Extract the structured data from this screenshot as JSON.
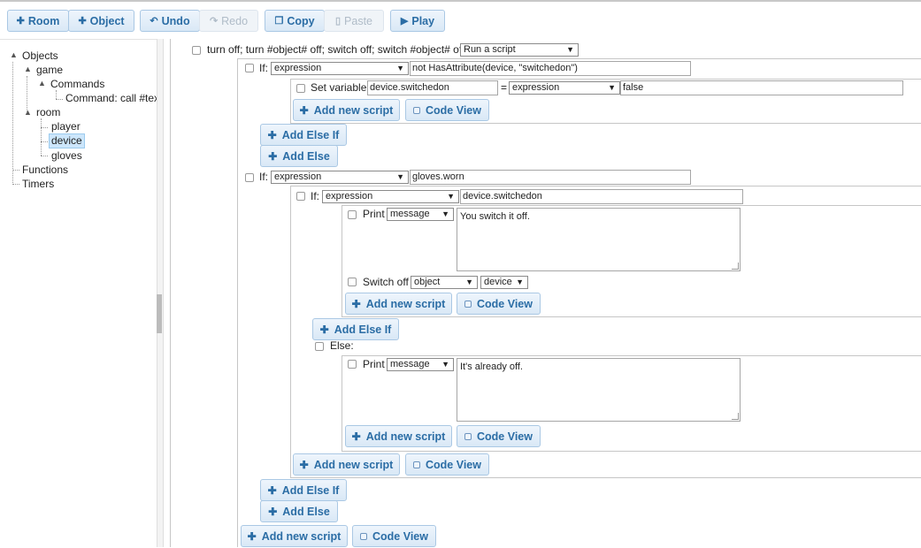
{
  "toolbar": {
    "room": "Room",
    "object": "Object",
    "undo": "Undo",
    "redo": "Redo",
    "copy": "Copy",
    "paste": "Paste",
    "play": "Play"
  },
  "tree": {
    "objects": "Objects",
    "game": "game",
    "commands": "Commands",
    "command_item": "Command: call #tex",
    "room": "room",
    "player": "player",
    "device": "device",
    "gloves": "gloves",
    "functions": "Functions",
    "timers": "Timers"
  },
  "script": {
    "header_label": "turn off; turn #object# off; switch off; switch #object# off",
    "header_type": "Run a script",
    "if_label": "If:",
    "else_label": "Else:",
    "expression_option": "expression",
    "if1_condition": "not HasAttribute(device, \"switchedon\")",
    "set_variable_label": "Set variable",
    "set_variable_name": "device.switchedon",
    "equals": "=",
    "set_variable_value": "false",
    "if2_condition": "gloves.worn",
    "if3_condition": "device.switchedon",
    "print_label": "Print",
    "message_option": "message",
    "print1_text": "You switch it off.",
    "switch_off_label": "Switch off",
    "object_option": "object",
    "device_option": "device",
    "print2_text": "It's already off.",
    "add_new_script": "Add new script",
    "code_view": "Code View",
    "add_else_if": "Add Else If",
    "add_else": "Add Else"
  }
}
